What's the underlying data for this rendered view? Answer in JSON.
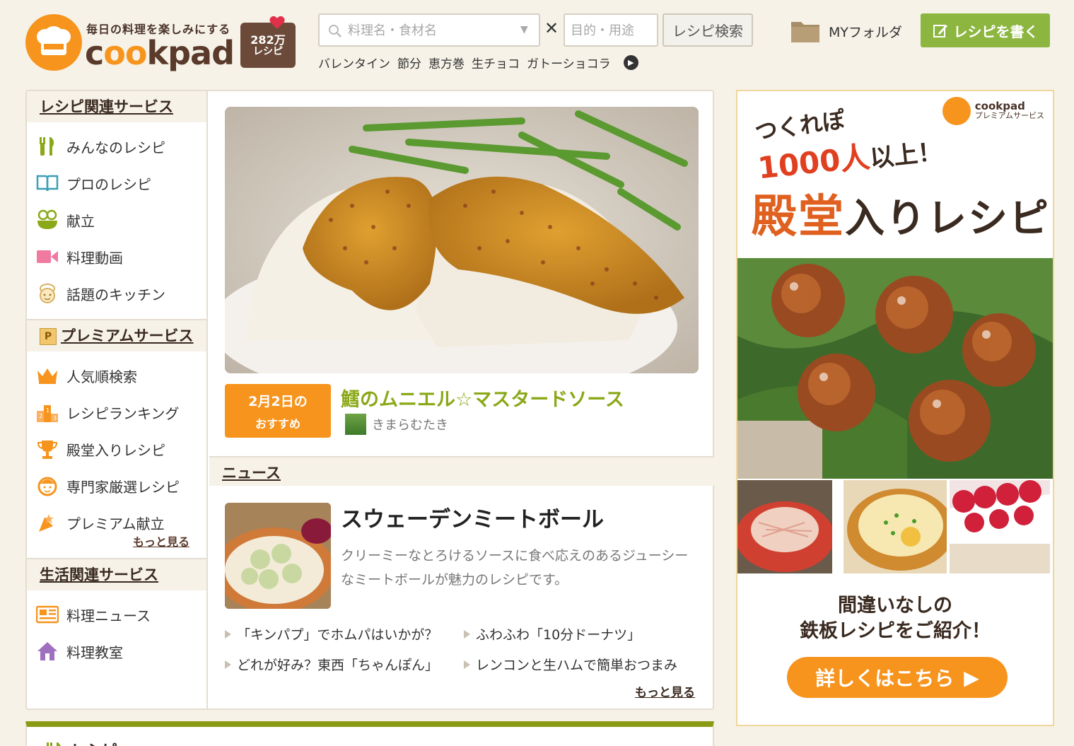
{
  "header": {
    "tagline": "毎日の料理を楽しみにする",
    "logo_word": "cookpad",
    "badge_count": "282万",
    "badge_unit": "レシピ",
    "search_placeholder": "料理名・食材名",
    "purpose_placeholder": "目的・用途",
    "search_button": "レシピ検索",
    "keywords": [
      "バレンタイン",
      "節分",
      "恵方巻",
      "生チョコ",
      "ガトーショコラ"
    ],
    "myfolder": "MYフォルダ",
    "write_button": "レシピを書く"
  },
  "sidebar": {
    "section1_title": "レシピ関連サービス",
    "section1_items": [
      "みんなのレシピ",
      "プロのレシピ",
      "献立",
      "料理動画",
      "話題のキッチン"
    ],
    "section2_title": "プレミアムサービス",
    "section2_items": [
      "人気順検索",
      "レシピランキング",
      "殿堂入りレシピ",
      "専門家厳選レシピ",
      "プレミアム献立"
    ],
    "more": "もっと見る",
    "section3_title": "生活関連サービス",
    "section3_items": [
      "料理ニュース",
      "料理教室"
    ]
  },
  "featured": {
    "date_line1": "2月2日の",
    "date_line2": "おすすめ",
    "title": "鱈のムニエル☆マスタードソース",
    "author": "きまらむたき"
  },
  "news": {
    "section_title": "ニュース",
    "title": "スウェーデンミートボール",
    "description": "クリーミーなとろけるソースに食べ応えのあるジューシーなミートボールが魅力のレシピです。",
    "links": [
      "「キンパプ」でホムパはいかが？",
      "ふわふわ「10分ドーナツ」",
      "どれが好み？東西「ちゃんぽん」",
      "レンコンと生ハムで簡単おつまみ"
    ],
    "more": "もっと見る"
  },
  "bottom": {
    "title": "レシピ"
  },
  "ad": {
    "logo_text": "cookpad",
    "logo_sub": "プレミアムサービス",
    "line1": "つくれぽ",
    "line2_big": "1000人",
    "line2_small": "以上！",
    "line3_big": "殿堂",
    "line3_small": "入りレシピ",
    "foot_line1": "間違いなしの",
    "foot_line2": "鉄板レシピをご紹介！",
    "button": "詳しくはこちら"
  },
  "colors": {
    "brand_orange": "#f7941d",
    "green": "#8cb640",
    "title_green": "#8aa817",
    "bg": "#f6f2e8"
  }
}
